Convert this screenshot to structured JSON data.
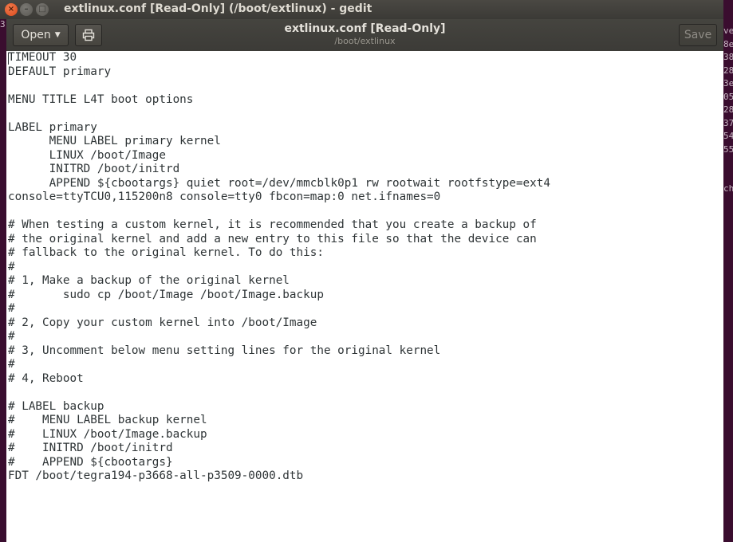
{
  "window": {
    "title": "extlinux.conf [Read-Only] (/boot/extlinux) - gedit",
    "controls": {
      "close": "×",
      "minimize": "–",
      "maximize": "□"
    }
  },
  "headerbar": {
    "open_label": "Open",
    "title": "extlinux.conf [Read-Only]",
    "subtitle": "/boot/extlinux",
    "save_label": "Save",
    "icons": {
      "open_dropdown": "chevron-down-icon",
      "print_preview": "print-preview-icon"
    }
  },
  "background_terminal": {
    "right_lines": [
      "ve",
      "8e",
      "38",
      "28",
      "3e",
      "05",
      "28",
      "37",
      "54",
      "55",
      "",
      "",
      "ch"
    ],
    "left_char": "3."
  },
  "editor": {
    "lines": [
      "TIMEOUT 30",
      "DEFAULT primary",
      "",
      "MENU TITLE L4T boot options",
      "",
      "LABEL primary",
      "      MENU LABEL primary kernel",
      "      LINUX /boot/Image",
      "      INITRD /boot/initrd",
      "      APPEND ${cbootargs} quiet root=/dev/mmcblk0p1 rw rootwait rootfstype=ext4",
      "console=ttyTCU0,115200n8 console=tty0 fbcon=map:0 net.ifnames=0",
      "",
      "# When testing a custom kernel, it is recommended that you create a backup of",
      "# the original kernel and add a new entry to this file so that the device can",
      "# fallback to the original kernel. To do this:",
      "#",
      "# 1, Make a backup of the original kernel",
      "#       sudo cp /boot/Image /boot/Image.backup",
      "#",
      "# 2, Copy your custom kernel into /boot/Image",
      "#",
      "# 3, Uncomment below menu setting lines for the original kernel",
      "#",
      "# 4, Reboot",
      "",
      "# LABEL backup",
      "#    MENU LABEL backup kernel",
      "#    LINUX /boot/Image.backup",
      "#    INITRD /boot/initrd",
      "#    APPEND ${cbootargs}",
      "FDT /boot/tegra194-p3668-all-p3509-0000.dtb"
    ]
  }
}
